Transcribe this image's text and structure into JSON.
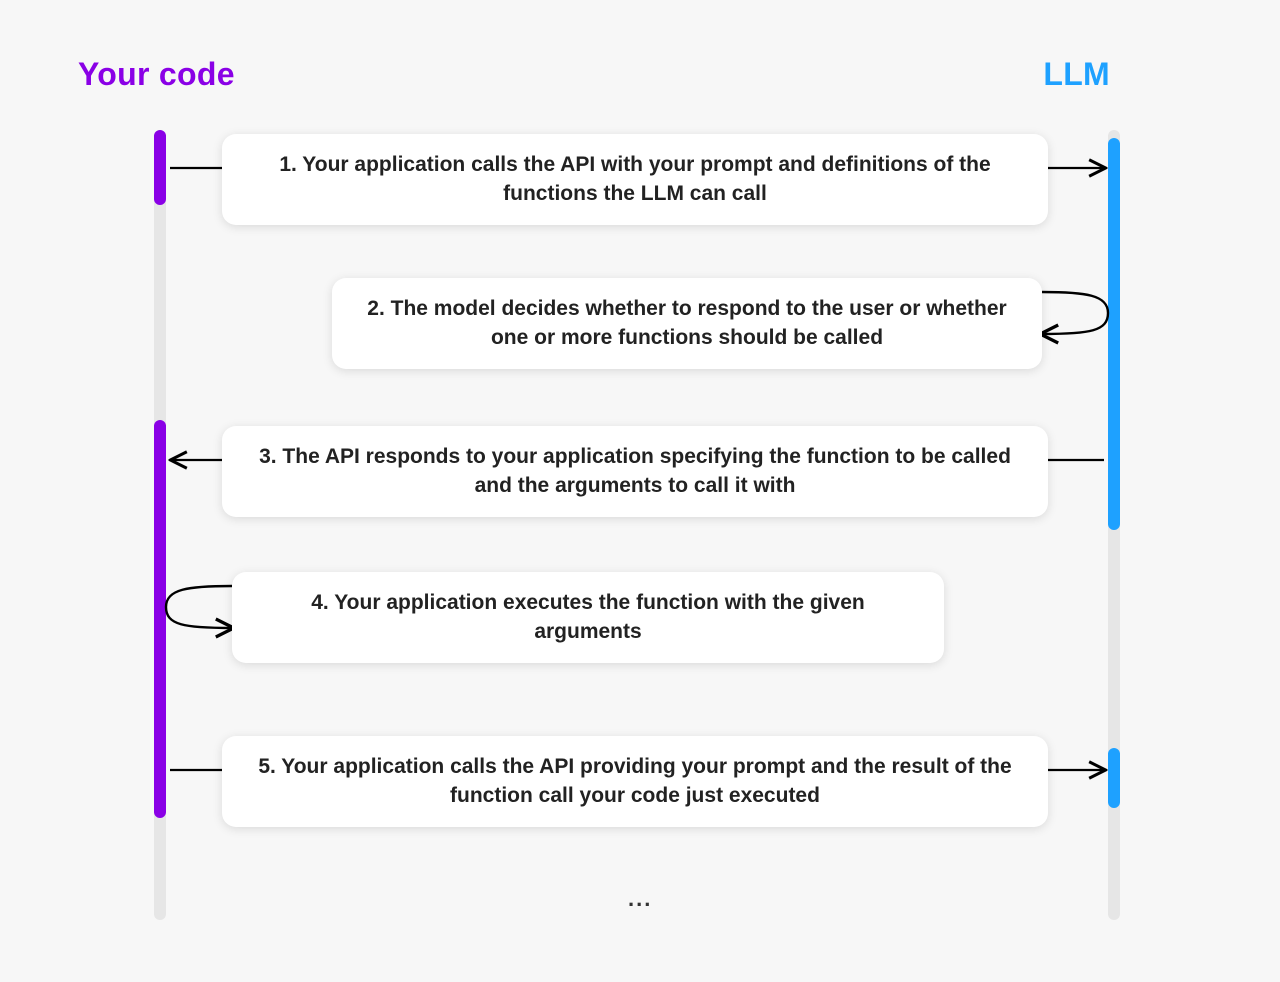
{
  "left_label": "Your code",
  "right_label": "LLM",
  "steps": {
    "s1": "1. Your application calls the API with your prompt and definitions of the functions the LLM can call",
    "s2": "2. The model decides whether to respond to the user or whether one or more functions should be called",
    "s3": "3. The API responds to your application specifying the function to be called and the arguments to call it with",
    "s4": "4. Your application executes the function with the given  arguments",
    "s5": "5. Your application calls the API providing your prompt and the result of the function call your code just executed"
  },
  "ellipsis": "...",
  "colors": {
    "your_code": "#8a00e6",
    "llm": "#1ea1ff",
    "background": "#f7f7f7",
    "card": "#ffffff"
  }
}
